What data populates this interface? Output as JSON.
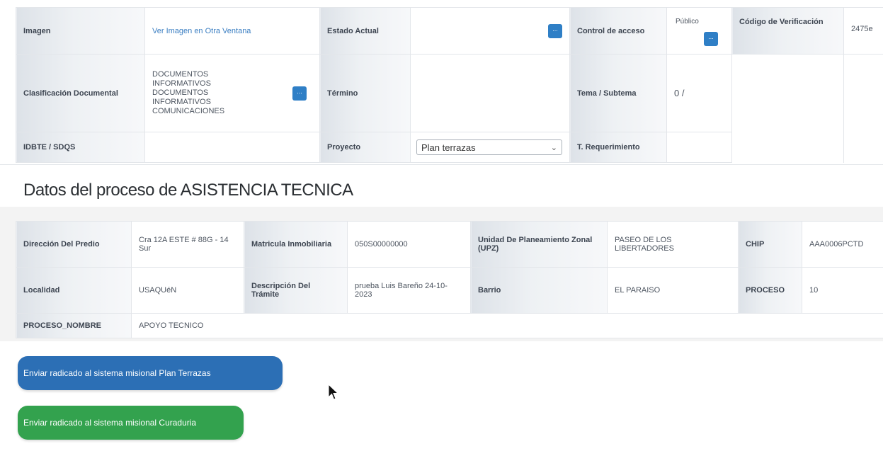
{
  "document_info": {
    "imagen_label": "Imagen",
    "imagen_link": "Ver Imagen en Otra Ventana",
    "estado_actual_label": "Estado Actual",
    "estado_actual_value": "",
    "control_acceso_label": "Control de acceso",
    "control_acceso_value": "Público",
    "codigo_verificacion_label": "Código de Verificación",
    "codigo_verificacion_value": "2475e",
    "clasificacion_label": "Clasificación Documental",
    "clasificacion_value": "DOCUMENTOS INFORMATIVOS DOCUMENTOS INFORMATIVOS COMUNICACIONES",
    "termino_label": "Término",
    "termino_value": "",
    "tema_label": "Tema / Subtema",
    "tema_value": "0 /",
    "idbte_label": "IDBTE / SDQS",
    "idbte_value": "",
    "proyecto_label": "Proyecto",
    "proyecto_selected": "Plan terrazas",
    "t_requerimiento_label": "T. Requerimiento",
    "t_requerimiento_value": "",
    "ellipsis_button": "..."
  },
  "section_title": "Datos del proceso de ASISTENCIA TECNICA",
  "process": {
    "direccion_label": "Dirección Del Predio",
    "direccion_value": "Cra 12A ESTE # 88G - 14 Sur",
    "matricula_label": "Matricula Inmobiliaria",
    "matricula_value": "050S00000000",
    "upz_label": "Unidad De Planeamiento Zonal (UPZ)",
    "upz_value": "PASEO DE LOS LIBERTADORES",
    "chip_label": "CHIP",
    "chip_value": "AAA0006PCTD",
    "localidad_label": "Localidad",
    "localidad_value": "USAQUéN",
    "descripcion_label": "Descripción Del Trámite",
    "descripcion_value": "prueba Luis Bareño 24-10-2023",
    "barrio_label": "Barrio",
    "barrio_value": "EL PARAISO",
    "proceso_label": "PROCESO",
    "proceso_value": "10",
    "proceso_nombre_label": "PROCESO_NOMBRE",
    "proceso_nombre_value": "APOYO TECNICO"
  },
  "actions": {
    "send_plan_terrazas": "Enviar radicado al sistema misional Plan Terrazas",
    "send_curaduria": "Enviar radicado al sistema misional Curaduria"
  },
  "colors": {
    "primary_button": "#2c6fb5",
    "success_button": "#33a24e",
    "link": "#3a7ec2",
    "mini_button": "#2f7fc6"
  }
}
